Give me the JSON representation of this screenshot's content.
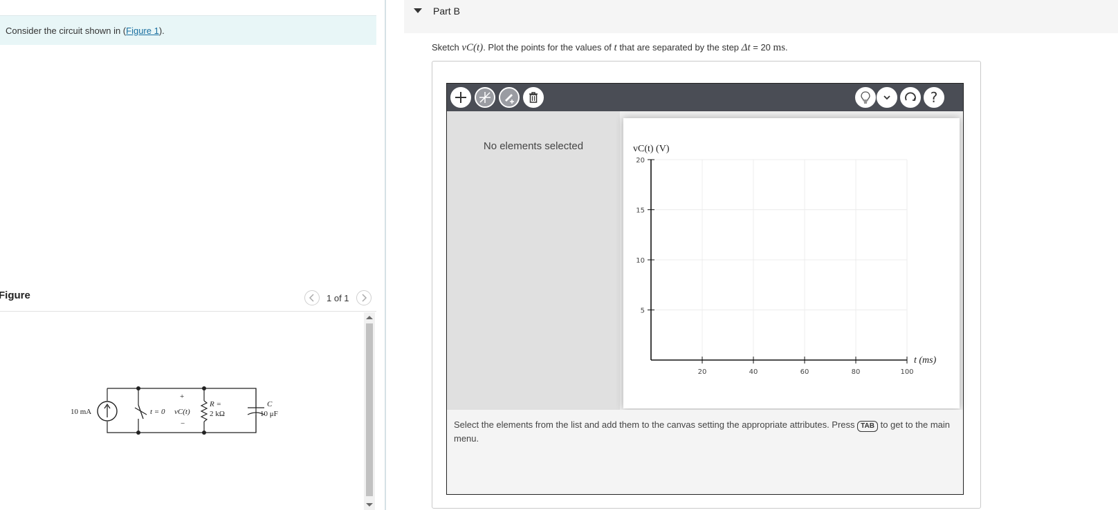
{
  "left": {
    "intro_text": "Consider the circuit shown in (",
    "intro_link": "Figure 1",
    "intro_after": ").",
    "figure_title": "Figure",
    "pager_text": "1 of 1",
    "circuit": {
      "source_label": "10 mA",
      "switch_label": "t = 0",
      "vc_label": "vC(t)",
      "plus": "+",
      "minus": "−",
      "r_label_top": "R =",
      "r_label_val": "2 kΩ",
      "c_label_top": "C",
      "c_label_val": "10 μF"
    }
  },
  "right": {
    "part_title": "Part B",
    "prompt": {
      "pre": "Sketch ",
      "var": "vC(t)",
      "mid": ". Plot the points for the values of ",
      "t": "t",
      "post": " that are separated by the step ",
      "step_sym": "Δt",
      "eq": " = 20 ",
      "unit": "ms",
      "end": "."
    },
    "no_selection": "No elements selected",
    "instructions_pre": "Select the elements from the list and add them to the canvas setting the appropriate attributes. Press ",
    "instructions_key": "TAB",
    "instructions_post": " to get to the main menu."
  },
  "toolbar_icons": [
    "add-icon",
    "no-slope-icon",
    "edit-point-icon",
    "trash-icon",
    "hint-lightbulb-icon",
    "chevron-down-icon",
    "reset-icon",
    "help-icon"
  ],
  "chart_data": {
    "type": "scatter",
    "title": "",
    "xlabel": "t (ms)",
    "ylabel": "vC(t) (V)",
    "xlim": [
      0,
      100
    ],
    "ylim": [
      0,
      20
    ],
    "x_ticks": [
      "20",
      "40",
      "60",
      "80",
      "100"
    ],
    "y_ticks": [
      "5",
      "10",
      "15",
      "20"
    ],
    "grid": true,
    "points": []
  }
}
